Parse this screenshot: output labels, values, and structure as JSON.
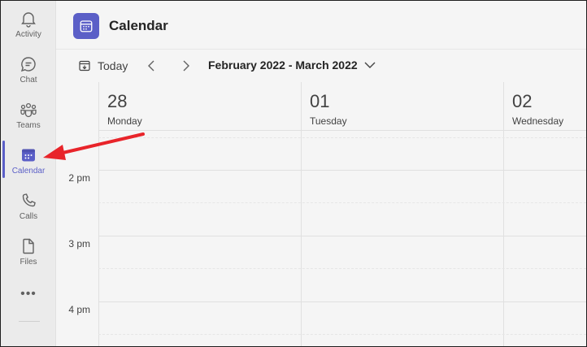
{
  "rail": {
    "items": [
      {
        "label": "Activity",
        "icon": "bell-icon"
      },
      {
        "label": "Chat",
        "icon": "chat-icon"
      },
      {
        "label": "Teams",
        "icon": "teams-icon"
      },
      {
        "label": "Calendar",
        "icon": "calendar-icon",
        "active": true
      },
      {
        "label": "Calls",
        "icon": "phone-icon"
      },
      {
        "label": "Files",
        "icon": "file-icon"
      }
    ],
    "more": "•••"
  },
  "header": {
    "title": "Calendar"
  },
  "toolbar": {
    "today_label": "Today",
    "range_label": "February 2022 - March 2022"
  },
  "days": [
    {
      "number": "28",
      "name": "Monday"
    },
    {
      "number": "01",
      "name": "Tuesday"
    },
    {
      "number": "02",
      "name": "Wednesday"
    }
  ],
  "times": [
    "2 pm",
    "3 pm",
    "4 pm"
  ],
  "colors": {
    "accent": "#5b5fc7",
    "annotation_arrow": "#e8242a"
  }
}
